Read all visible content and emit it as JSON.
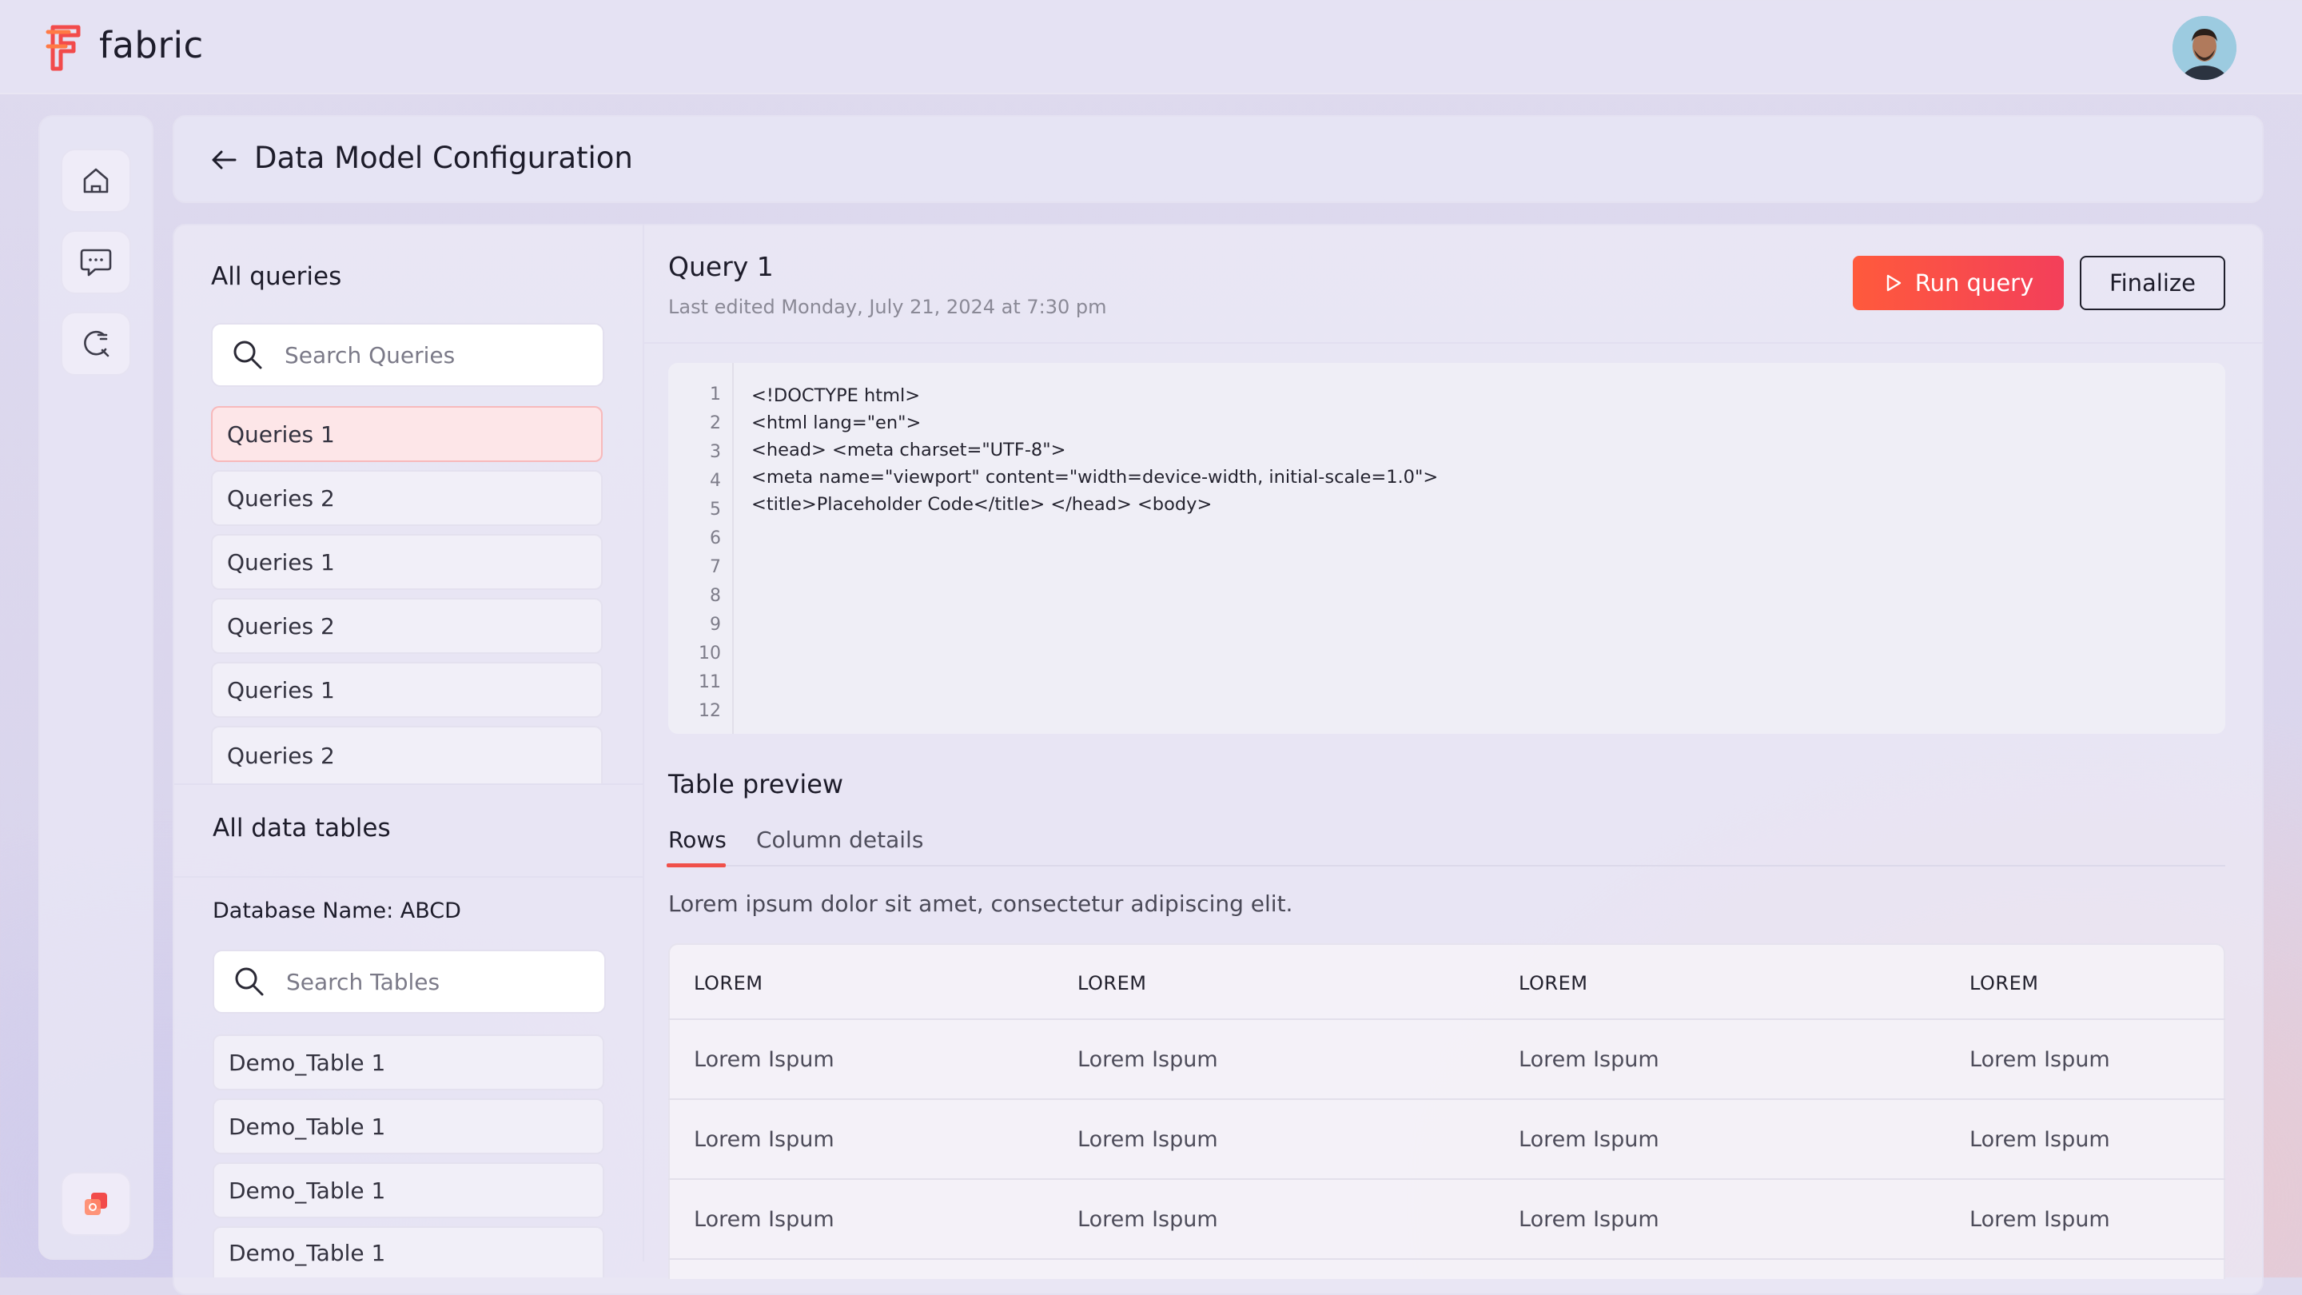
{
  "app": {
    "brand": "fabric"
  },
  "header": {
    "page_title": "Data Model Configuration"
  },
  "rail": {
    "icons": [
      "home-icon",
      "chat-icon",
      "search-refresh-icon",
      "apps-icon"
    ]
  },
  "queries": {
    "heading": "All queries",
    "search_placeholder": "Search Queries",
    "items": [
      "Queries 1",
      "Queries 2",
      "Queries 1",
      "Queries 2",
      "Queries 1",
      "Queries 2"
    ],
    "active_index": 0
  },
  "tables": {
    "heading": "All data tables",
    "database_label": "Database Name: ABCD",
    "search_placeholder": "Search Tables",
    "items": [
      "Demo_Table 1",
      "Demo_Table 1",
      "Demo_Table 1",
      "Demo_Table 1"
    ]
  },
  "query": {
    "title": "Query 1",
    "last_edited": "Last edited Monday, July 21, 2024 at 7:30 pm",
    "run_label": "Run query",
    "finalize_label": "Finalize"
  },
  "editor": {
    "line_numbers": [
      "1",
      "2",
      "3",
      "4",
      "5",
      "6",
      "7",
      "8",
      "9",
      "10",
      "11",
      "12"
    ],
    "lines": [
      "<!DOCTYPE html>",
      "<html lang=\"en\">",
      "<head> <meta charset=\"UTF-8\">",
      "<meta name=\"viewport\" content=\"width=device-width, initial-scale=1.0\">",
      "<title>Placeholder Code</title> </head> <body>"
    ]
  },
  "preview": {
    "title": "Table preview",
    "tabs": [
      "Rows",
      "Column details"
    ],
    "active_tab": "Rows",
    "description": "Lorem ipsum dolor sit amet, consectetur adipiscing elit.",
    "columns": [
      "LOREM",
      "LOREM",
      "LOREM",
      "LOREM"
    ],
    "rows": [
      [
        "Lorem Ispum",
        "Lorem Ispum",
        "Lorem Ispum",
        "Lorem Ispum"
      ],
      [
        "Lorem Ispum",
        "Lorem Ispum",
        "Lorem Ispum",
        "Lorem Ispum"
      ],
      [
        "Lorem Ispum",
        "Lorem Ispum",
        "Lorem Ispum",
        "Lorem Ispum"
      ]
    ]
  },
  "colors": {
    "accent": "#f0504a",
    "accent_gradient_start": "#ff5a3c",
    "accent_gradient_end": "#f33f5a"
  }
}
